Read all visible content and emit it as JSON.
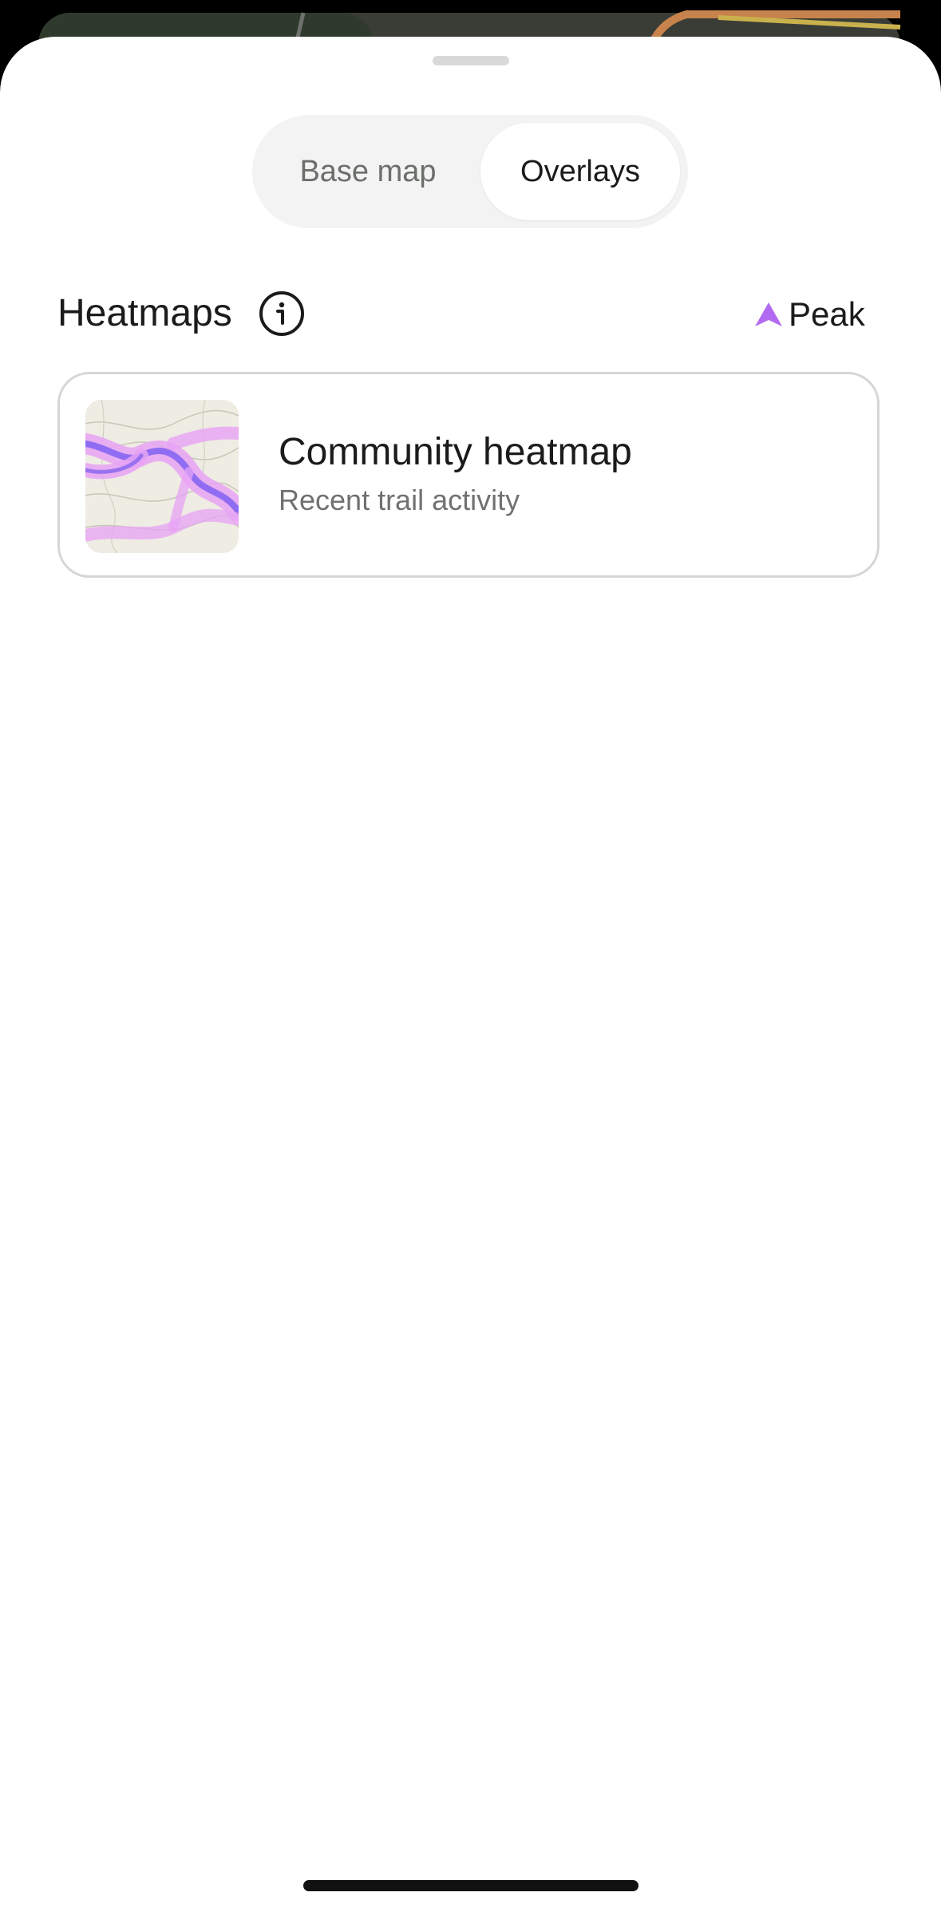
{
  "tabs": {
    "base_map": "Base map",
    "overlays": "Overlays",
    "selected": "Overlays"
  },
  "section": {
    "title": "Heatmaps",
    "badge": "Peak",
    "badge_icon": "peak-logo-icon",
    "info_icon": "info-icon"
  },
  "heatmap_card": {
    "title": "Community heatmap",
    "subtitle": "Recent trail activity",
    "thumbnail_icon": "heatmap-thumbnail"
  },
  "colors": {
    "accent": "#b26bf0",
    "heat_light": "#e7a3f5",
    "heat_core": "#8f6cf2",
    "text_primary": "#1b1c1a",
    "text_secondary": "#6f726e",
    "segmented_bg": "#f3f3f3",
    "card_border": "#d6d6d6"
  }
}
